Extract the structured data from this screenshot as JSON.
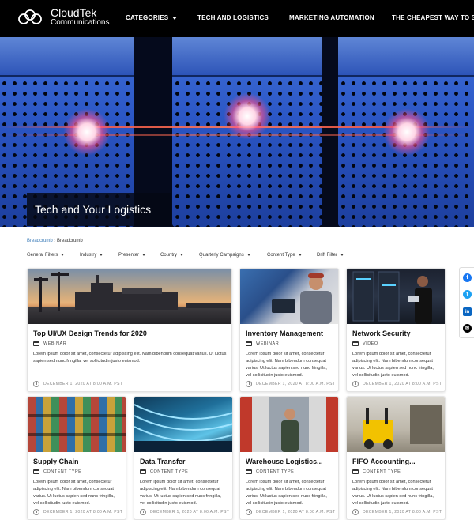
{
  "header": {
    "logo_name": "CloudTek",
    "logo_sub": "Communications",
    "nav": [
      {
        "label": "CATEGORIES",
        "dropdown": true
      },
      {
        "label": "TECH AND LOGISTICS",
        "dropdown": false
      },
      {
        "label": "MARKETING AUTOMATION",
        "dropdown": false
      },
      {
        "label": "THE CHEAPEST WAY TO SHIP",
        "dropdown": false
      }
    ]
  },
  "hero": {
    "title": "Tech and Your Logistics"
  },
  "breadcrumb": {
    "link": "Breadcrumb",
    "separator": "›",
    "current": "Breadcrumb"
  },
  "filters": [
    "General Filters",
    "Industry",
    "Presenter",
    "Country",
    "Quarterly Campaigns",
    "Content Type",
    "Drift Filter"
  ],
  "cards": [
    {
      "title": "Top UI/UX Design Trends for 2020",
      "type": "WEBINAR",
      "desc": "Lorem ipsum dolor sit amet, consectetur adipiscing elit. Nam bibendum consequat varius. Ut luctus sapien sed nunc fringilla, vel sollicitudin justo euismod.",
      "date": "DECEMBER 1, 2020 AT 8:00 A.M. PST",
      "image": "port-cranes-sunset"
    },
    {
      "title": "Inventory Management",
      "type": "WEBINAR",
      "desc": "Lorem ipsum dolor sit amet, consectetur adipiscing elit. Nam bibendum consequat varius. Ut luctus sapien sed nunc fringilla, vel sollicitudin justo euismod.",
      "date": "DECEMBER 1, 2020 AT 8:00 A.M. PST",
      "image": "worker-with-tablet"
    },
    {
      "title": "Network Security",
      "type": "VIDEO",
      "desc": "Lorem ipsum dolor sit amet, consectetur adipiscing elit. Nam bibendum consequat varius. Ut luctus sapien sed nunc fringilla, vel sollicitudin justo euismod.",
      "date": "DECEMBER 1, 2020 AT 8:00 A.M. PST",
      "image": "server-room-woman"
    },
    {
      "title": "Supply Chain",
      "type": "CONTENT TYPE",
      "desc": "Lorem ipsum dolor sit amet, consectetur adipiscing elit. Nam bibendum consequat varius. Ut luctus sapien sed nunc fringilla, vel sollicitudin justo euismod.",
      "date": "DECEMBER 1, 2020 AT 8:00 A.M. PST",
      "image": "aerial-containers"
    },
    {
      "title": "Data Transfer",
      "type": "CONTENT TYPE",
      "desc": "Lorem ipsum dolor sit amet, consectetur adipiscing elit. Nam bibendum consequat varius. Ut luctus sapien sed nunc fringilla, vel sollicitudin justo euismod.",
      "date": "DECEMBER 1, 2020 AT 8:00 A.M. PST",
      "image": "network-cables"
    },
    {
      "title": "Warehouse Logistics...",
      "type": "CONTENT TYPE",
      "desc": "Lorem ipsum dolor sit amet, consectetur adipiscing elit. Nam bibendum consequat varius. Ut luctus sapien sed nunc fringilla, vel sollicitudin justo euismod.",
      "date": "DECEMBER 1, 2020 AT 8:00 A.M. PST",
      "image": "warehouse-aisle-man"
    },
    {
      "title": "FIFO Accounting...",
      "type": "CONTENT TYPE",
      "desc": "Lorem ipsum dolor sit amet, consectetur adipiscing elit. Nam bibendum consequat varius. Ut luctus sapien sed nunc fringilla, vel sollicitudin justo euismod.",
      "date": "DECEMBER 1, 2020 AT 8:00 A.M. PST",
      "image": "forklift-warehouse"
    }
  ],
  "social": [
    {
      "icon": "facebook-icon",
      "glyph": "f",
      "color": "#1877f2"
    },
    {
      "icon": "twitter-icon",
      "glyph": "t",
      "color": "#1da1f2"
    },
    {
      "icon": "linkedin-icon",
      "glyph": "in",
      "color": "#0a66c2"
    },
    {
      "icon": "email-icon",
      "glyph": "✉",
      "color": "#000000"
    }
  ],
  "colors": {
    "header_bg": "#000000",
    "breadcrumb_link": "#3a7bb8"
  }
}
